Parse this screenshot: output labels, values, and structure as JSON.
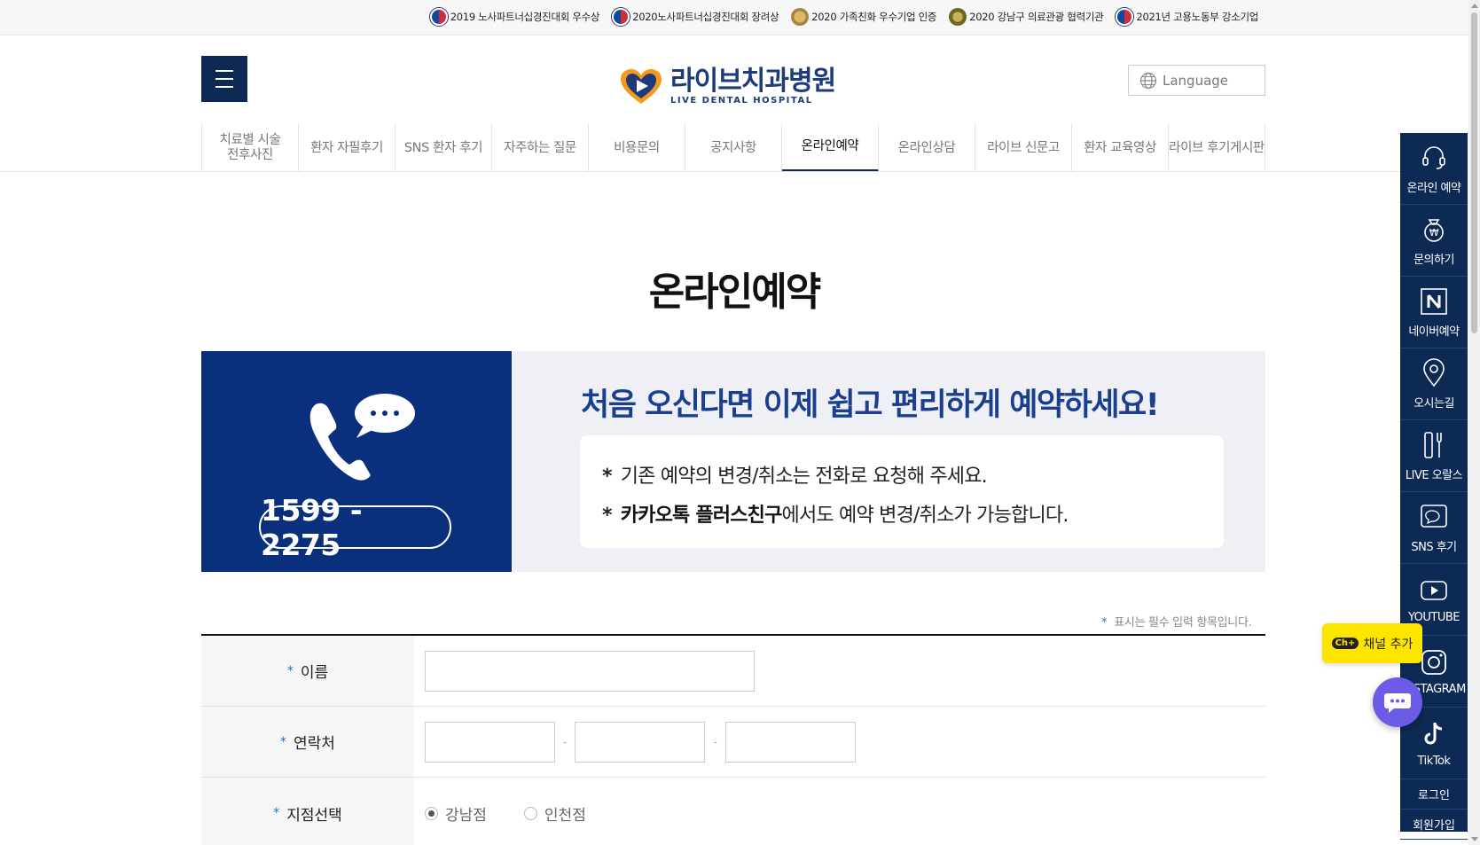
{
  "awards": [
    {
      "text": "2019 노사파트너십경진대회 우수상",
      "icon": "korea-emblem-icon"
    },
    {
      "text": "2020노사파트너십경진대회 장려상",
      "icon": "korea-emblem-icon"
    },
    {
      "text": "2020 가족친화 우수기업 인증",
      "icon": "family-certification-icon"
    },
    {
      "text": "2020 강남구 의료관광 협력기관",
      "icon": "gangnam-emblem-icon"
    },
    {
      "text": "2021년 고용노동부 강소기업",
      "icon": "korea-emblem-icon"
    }
  ],
  "header": {
    "logo_ko": "라이브치과병원",
    "logo_en": "LIVE DENTAL HOSPITAL",
    "language_label": "Language"
  },
  "nav": [
    {
      "label": "치료별 시술\n전후사진",
      "active": false
    },
    {
      "label": "환자 자필후기",
      "active": false
    },
    {
      "label": "SNS 환자 후기",
      "active": false
    },
    {
      "label": "자주하는 질문",
      "active": false
    },
    {
      "label": "비용문의",
      "active": false
    },
    {
      "label": "공지사항",
      "active": false
    },
    {
      "label": "온라인예약",
      "active": true
    },
    {
      "label": "온라인상담",
      "active": false
    },
    {
      "label": "라이브 신문고",
      "active": false
    },
    {
      "label": "환자 교육영상",
      "active": false
    },
    {
      "label": "라이브 후기게시판",
      "active": false
    }
  ],
  "page_title": "온라인예약",
  "banner": {
    "phone": "1599 - 2275",
    "title": "처음 오신다면 이제 쉽고 편리하게 예약하세요!",
    "note1": "기존 예약의 변경/취소는 전화로 요청해 주세요.",
    "note2_bold": "카카오톡 플러스친구",
    "note2_rest": "에서도 예약 변경/취소가 가능합니다."
  },
  "form": {
    "required_note": "표시는 필수 입력 항목입니다.",
    "required_mark": "*",
    "name_label": "이름",
    "phone_label": "연락처",
    "branch_label": "지점선택",
    "phone_separator": "-",
    "branches": [
      {
        "label": "강남점",
        "selected": true
      },
      {
        "label": "인천점",
        "selected": false
      }
    ]
  },
  "quickbar": [
    {
      "label": "온라인 예약",
      "icon": "headset-icon"
    },
    {
      "label": "문의하기",
      "icon": "money-bag-icon"
    },
    {
      "label": "네이버예약",
      "icon": "naver-icon"
    },
    {
      "label": "오시는길",
      "icon": "map-pin-icon"
    },
    {
      "label": "LIVE 오랄스",
      "icon": "toothbrush-icon"
    },
    {
      "label": "SNS 후기",
      "icon": "chat-bubble-icon"
    },
    {
      "label": "YOUTUBE",
      "icon": "youtube-icon"
    },
    {
      "label": "INSTAGRAM",
      "icon": "instagram-icon"
    },
    {
      "label": "TikTok",
      "icon": "tiktok-icon"
    }
  ],
  "quick_small": [
    "로그인",
    "회원가입"
  ],
  "kakao": {
    "ch": "Ch+",
    "label": "채널 추가"
  },
  "colors": {
    "navy": "#0d2a55",
    "banner_blue": "#0a2f7c",
    "accent": "#1b3f8f",
    "kakao": "#fee500",
    "chat": "#6b5ce7"
  }
}
